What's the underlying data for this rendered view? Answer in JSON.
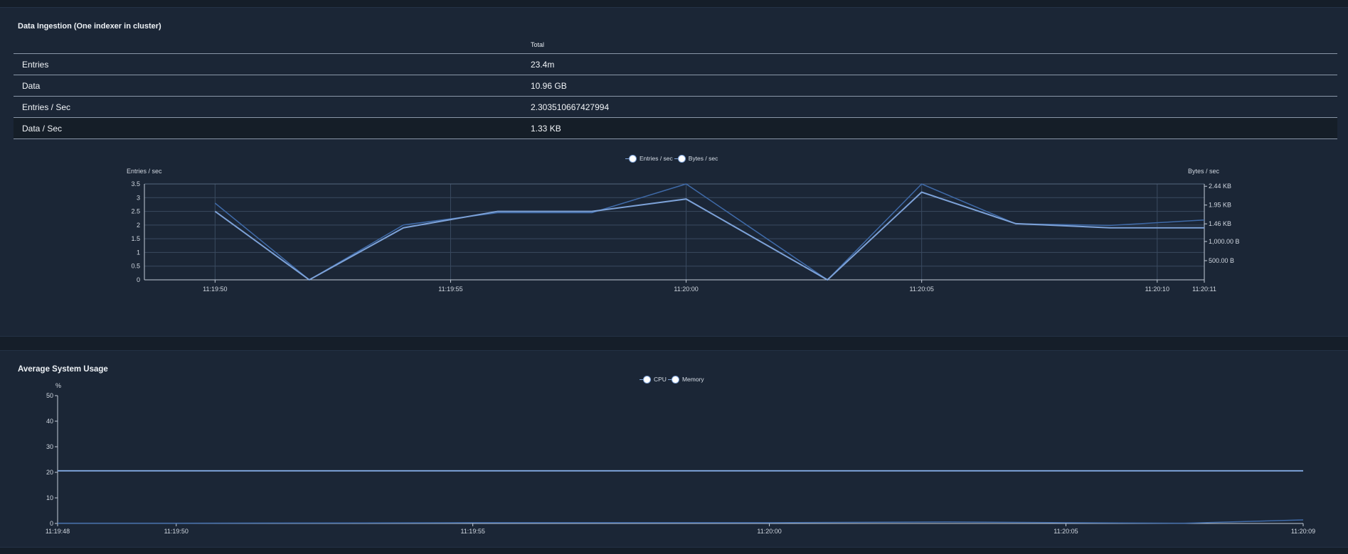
{
  "ingestion": {
    "title": "Data Ingestion (One indexer in cluster)",
    "table": {
      "header": "Total",
      "rows": [
        {
          "label": "Entries",
          "value": "23.4m"
        },
        {
          "label": "Data",
          "value": "10.96 GB"
        },
        {
          "label": "Entries / Sec",
          "value": "2.303510667427994"
        },
        {
          "label": "Data / Sec",
          "value": "1.33 KB"
        }
      ]
    },
    "legend": [
      "Entries / sec",
      "Bytes / sec"
    ]
  },
  "system": {
    "title": "Average System Usage",
    "legend": [
      "CPU",
      "Memory"
    ]
  },
  "colors": {
    "series_primary": "#7da2d8",
    "series_secondary": "#3f6aa8",
    "axis": "#c3ccd8",
    "grid": "#3a4a60"
  },
  "chart_data": [
    {
      "type": "line",
      "ylabel": "Entries / sec",
      "y2label": "Bytes / sec",
      "x": [
        "11:19:50",
        "11:19:52",
        "11:19:54",
        "11:19:56",
        "11:19:58",
        "11:20:00",
        "11:20:03",
        "11:20:05",
        "11:20:07",
        "11:20:09",
        "11:20:11"
      ],
      "xticks": [
        "11:19:50",
        "11:19:55",
        "11:20:00",
        "11:20:05",
        "11:20:10",
        "11:20:11"
      ],
      "ylim": [
        0,
        3.5
      ],
      "yticks": [
        "0",
        "0.5",
        "1",
        "1.5",
        "2",
        "2.5",
        "3",
        "3.5"
      ],
      "y2ticks": [
        "500.00  B",
        "1,000.00  B",
        "1.46 KB",
        "1.95 KB",
        "2.44 KB"
      ],
      "y2lim": [
        0,
        2500
      ],
      "series": [
        {
          "name": "Entries / sec",
          "values": [
            2.5,
            0,
            1.9,
            2.5,
            2.5,
            2.95,
            0,
            3.2,
            2.05,
            1.9,
            1.9
          ]
        },
        {
          "name": "Bytes / sec",
          "values": [
            2000,
            0,
            1430,
            1750,
            1750,
            2500,
            0,
            2500,
            1460,
            1420,
            1560
          ]
        }
      ]
    },
    {
      "type": "line",
      "ylabel": "%",
      "x": [
        "11:19:48",
        "11:19:50",
        "11:19:55",
        "11:20:00",
        "11:20:03",
        "11:20:05",
        "11:20:07",
        "11:20:09"
      ],
      "xticks": [
        "11:19:48",
        "11:19:50",
        "11:19:55",
        "11:20:00",
        "11:20:05",
        "11:20:09"
      ],
      "ylim": [
        0,
        50
      ],
      "yticks": [
        "0",
        "10",
        "20",
        "30",
        "40",
        "50"
      ],
      "series": [
        {
          "name": "CPU",
          "values": [
            0.1,
            0.1,
            0.3,
            0.3,
            0.6,
            0.3,
            0.1,
            1.4
          ]
        },
        {
          "name": "Memory",
          "values": [
            20.6,
            20.6,
            20.6,
            20.6,
            20.6,
            20.6,
            20.6,
            20.6
          ]
        }
      ]
    }
  ]
}
